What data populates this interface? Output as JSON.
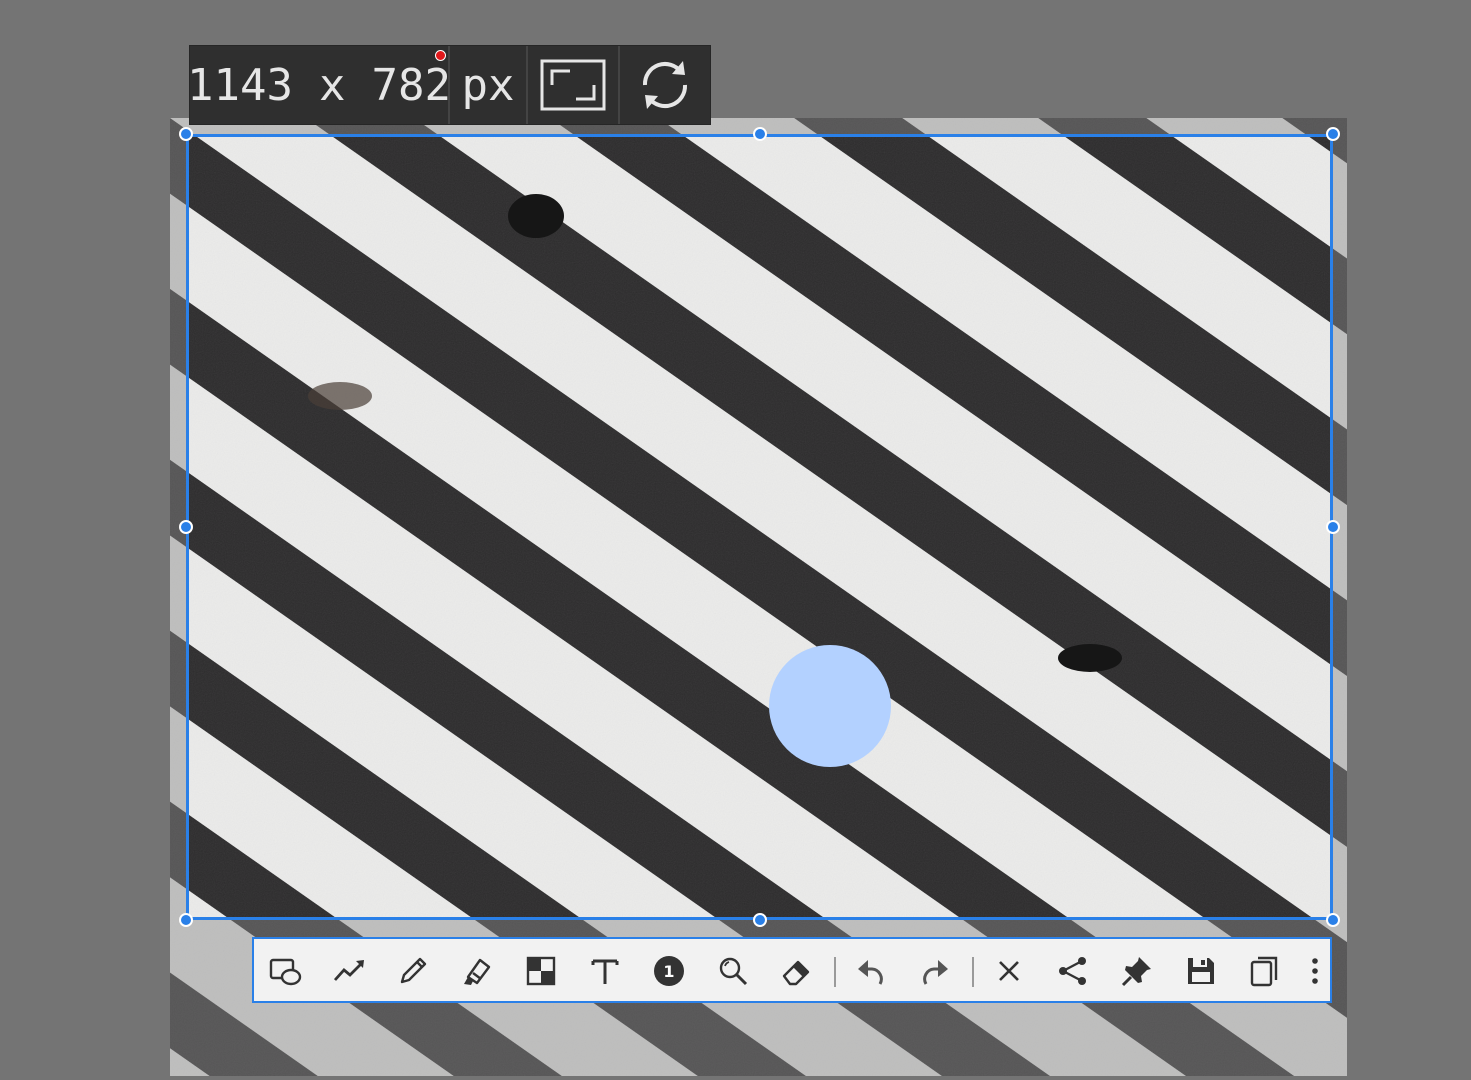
{
  "size_box": {
    "width": "1143",
    "separator": "x",
    "height": "782",
    "unit": "px",
    "aspect_button": "aspect-ratio-icon",
    "refresh_button": "refresh-icon"
  },
  "colors": {
    "selection": "#2a80e8",
    "marker": "#b3d1ff",
    "toolbar_bg": "#f2f2f2",
    "backdrop": "#747474"
  },
  "toolbar": {
    "tools": [
      "shape-icon",
      "line-icon",
      "pencil-icon",
      "marker-icon",
      "mosaic-icon",
      "text-icon",
      "number-icon",
      "magnifier-icon",
      "eraser-icon",
      "undo-icon",
      "redo-icon",
      "close-icon",
      "share-icon",
      "pin-icon",
      "save-icon",
      "copy-icon",
      "more-icon"
    ],
    "counter_label": "1",
    "text_tool_label": "T"
  }
}
